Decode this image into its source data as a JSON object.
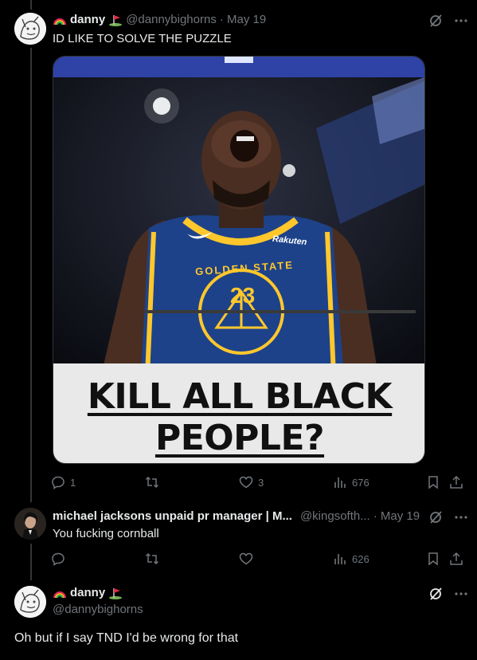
{
  "colors": {
    "background": "#000000",
    "text": "#e7e9ea",
    "muted": "#71767b",
    "thread": "#333639",
    "jersey": "#1d428a",
    "gold": "#ffc72c"
  },
  "tweet1": {
    "display_name": "danny",
    "name_badges": [
      "rainbow-emoji",
      "golf-flag-emoji"
    ],
    "handle": "@dannybighorns",
    "date": "· May 19",
    "text": "ID LIKE TO SOLVE THE PUZZLE",
    "image": {
      "caption_line1": "KILL ALL BLACK",
      "caption_line2": "PEOPLE?",
      "jersey_brand": "Rakuten",
      "jersey_text": "GOLDEN STATE",
      "jersey_number": "23"
    },
    "actions": {
      "replies": "1",
      "reposts": "",
      "likes": "3",
      "views": "676"
    }
  },
  "tweet2": {
    "display_name": "michael jacksons unpaid pr manager | M...",
    "handle": "@kingsofth...",
    "date": "· May 19",
    "text": "You fucking cornball",
    "actions": {
      "replies": "",
      "reposts": "",
      "likes": "",
      "views": "626"
    }
  },
  "tweet3": {
    "display_name": "danny",
    "name_badges": [
      "rainbow-emoji",
      "golf-flag-emoji"
    ],
    "handle": "@dannybighorns",
    "text": "Oh but if I say TND I'd be wrong for that"
  },
  "icons": [
    "grok-icon",
    "more-icon",
    "reply-icon",
    "repost-icon",
    "like-icon",
    "views-icon",
    "bookmark-icon",
    "share-icon"
  ]
}
